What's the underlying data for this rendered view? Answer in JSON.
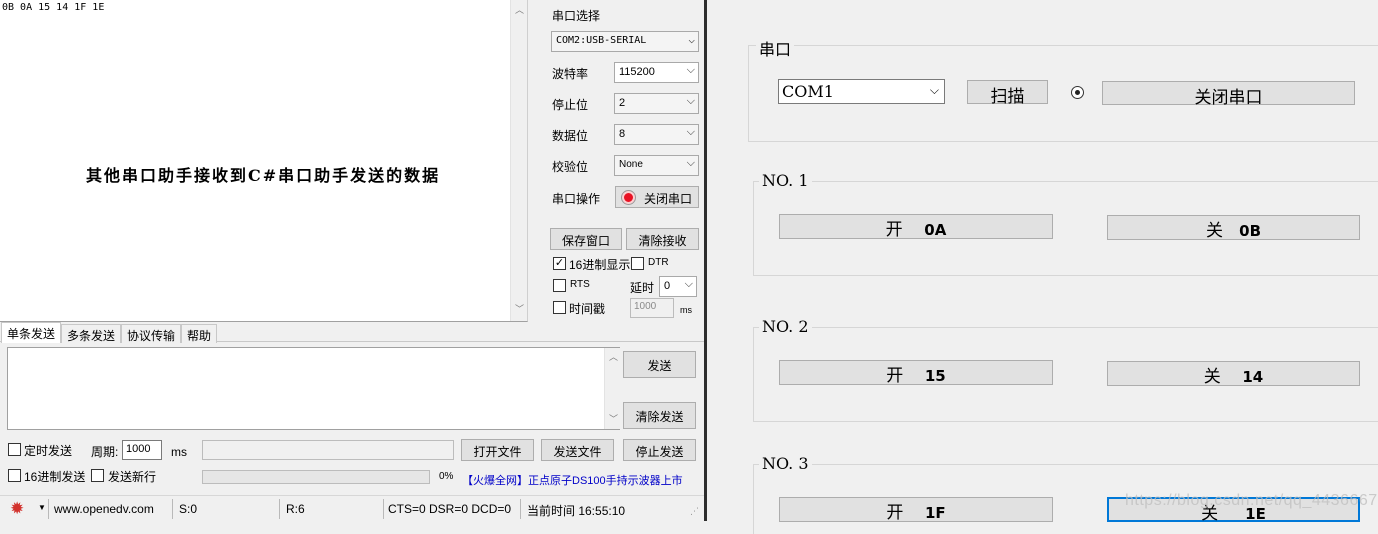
{
  "left_app": {
    "receive": {
      "text": "0B 0A 15 14 1F 1E",
      "caption": "其他串口助手接收到C#串口助手发送的数据"
    },
    "settings": {
      "port_select_label": "串口选择",
      "port_value": "COM2:USB-SERIAL",
      "baud_label": "波特率",
      "baud_value": "115200",
      "stopbits_label": "停止位",
      "stopbits_value": "2",
      "databits_label": "数据位",
      "databits_value": "8",
      "parity_label": "校验位",
      "parity_value": "None",
      "port_op_label": "串口操作",
      "port_op_button": "关闭串口",
      "port_op_status_color": "#e81123"
    },
    "buttons": {
      "save_window": "保存窗口",
      "clear_receive": "清除接收",
      "send": "发送",
      "clear_send": "清除发送",
      "open_file": "打开文件",
      "send_file": "发送文件",
      "stop_send": "停止发送"
    },
    "options": {
      "hex_display": {
        "label": "16进制显示",
        "checked": true
      },
      "dtr": {
        "label": "DTR",
        "checked": false
      },
      "rts": {
        "label": "RTS",
        "checked": false
      },
      "delay_label": "延时",
      "delay_value": "0",
      "timestamp": {
        "label": "时间戳",
        "checked": false
      },
      "timestamp_value": "1000",
      "timestamp_unit": "ms"
    },
    "tabs": [
      "单条发送",
      "多条发送",
      "协议传输",
      "帮助"
    ],
    "send_options": {
      "timed_send": {
        "label": "定时发送",
        "checked": false
      },
      "period_label": "周期:",
      "period_value": "1000",
      "period_unit": "ms",
      "hex_send": {
        "label": "16进制发送",
        "checked": false
      },
      "newline": {
        "label": "发送新行",
        "checked": false
      },
      "progress_percent": "0%",
      "ad_text": "【火爆全网】正点原子DS100手持示波器上市",
      "ad_color": "#0000c8"
    },
    "statusbar": {
      "website": "www.openedv.com",
      "sent": "S:0",
      "received": "R:6",
      "lines": "CTS=0 DSR=0 DCD=0",
      "time": "当前时间 16:55:10"
    }
  },
  "right_app": {
    "port_group": {
      "title": "串口",
      "port_value": "COM1",
      "scan_button": "扫描",
      "close_button": "关闭串口"
    },
    "groups": [
      {
        "title": "NO. 1",
        "on_label": "开",
        "on_code": "0A",
        "off_label": "关",
        "off_code": "0B"
      },
      {
        "title": "NO. 2",
        "on_label": "开",
        "on_code": "15",
        "off_label": "关",
        "off_code": "14"
      },
      {
        "title": "NO. 3",
        "on_label": "开",
        "on_code": "1F",
        "off_label": "关",
        "off_code": "1E"
      }
    ],
    "watermark": "https://blog.csdn.net/qq_44366677"
  }
}
